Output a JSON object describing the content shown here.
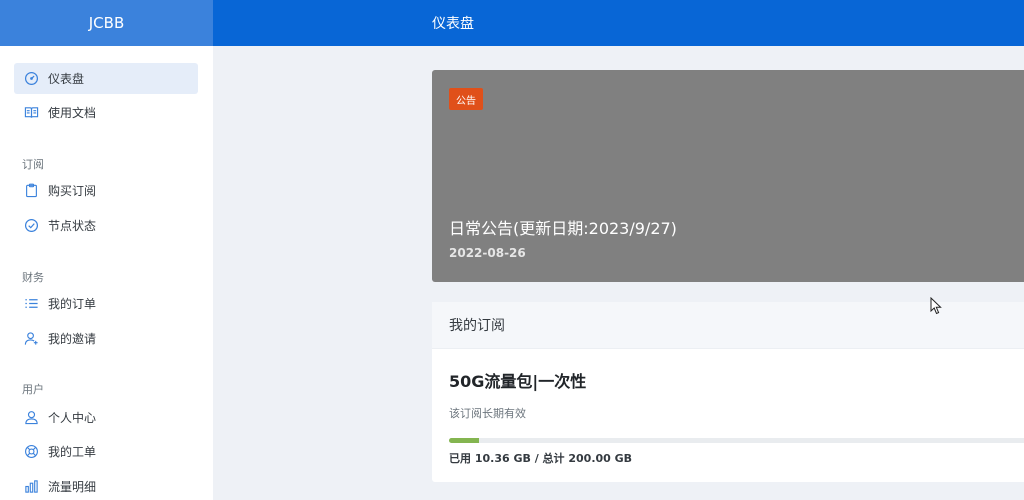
{
  "header": {
    "brand": "JCBB",
    "page_title": "仪表盘"
  },
  "sidebar": {
    "items_top": [
      {
        "label": "仪表盘",
        "icon": "gauge-icon",
        "active": true
      },
      {
        "label": "使用文档",
        "icon": "book-icon"
      }
    ],
    "sections": [
      {
        "title": "订阅",
        "items": [
          {
            "label": "购买订阅",
            "icon": "clipboard-icon"
          },
          {
            "label": "节点状态",
            "icon": "check-circle-icon"
          }
        ]
      },
      {
        "title": "财务",
        "items": [
          {
            "label": "我的订单",
            "icon": "list-icon"
          },
          {
            "label": "我的邀请",
            "icon": "user-plus-icon"
          }
        ]
      },
      {
        "title": "用户",
        "items": [
          {
            "label": "个人中心",
            "icon": "user-icon"
          },
          {
            "label": "我的工单",
            "icon": "lifebuoy-icon"
          },
          {
            "label": "流量明细",
            "icon": "bar-chart-icon"
          }
        ]
      }
    ]
  },
  "notice": {
    "badge": "公告",
    "title": "日常公告(更新日期:2023/9/27)",
    "date": "2022-08-26"
  },
  "subscription": {
    "header": "我的订阅",
    "plan_name": "50G流量包|一次性",
    "validity": "该订阅长期有效",
    "usage_text": "已用 10.36 GB / 总计 200.00 GB",
    "usage_fraction": 0.052
  },
  "colors": {
    "header_blue": "#0866d6",
    "brand_blue": "#3b82dc",
    "badge_orange": "#e0501a",
    "progress_green": "#84b550"
  }
}
